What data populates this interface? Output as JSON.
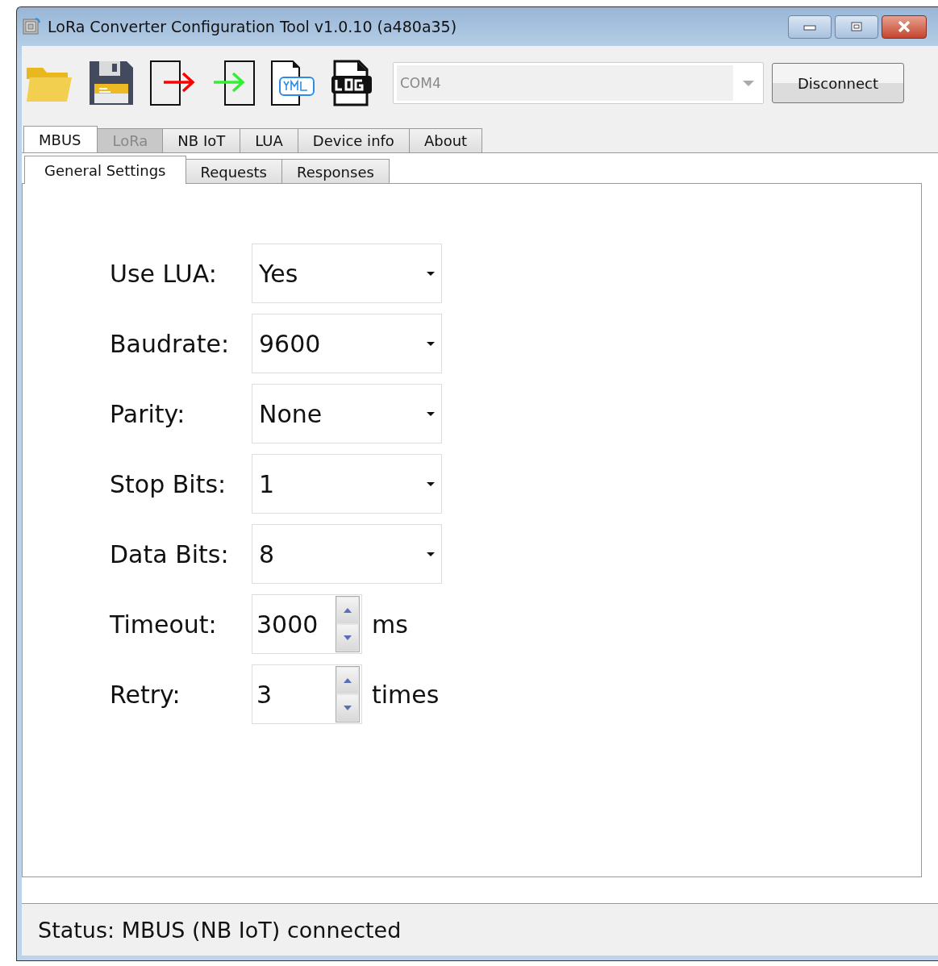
{
  "window": {
    "title": "LoRa Converter Configuration Tool v1.0.10 (a480a35)"
  },
  "toolbar": {
    "port": {
      "value": "COM4",
      "disabled": true
    },
    "disconnect_button": "Disconnect"
  },
  "tabs": [
    {
      "label": "MBUS",
      "selected": true,
      "disabled": false
    },
    {
      "label": "LoRa",
      "selected": false,
      "disabled": true
    },
    {
      "label": "NB IoT",
      "selected": false,
      "disabled": false
    },
    {
      "label": "LUA",
      "selected": false,
      "disabled": false
    },
    {
      "label": "Device info",
      "selected": false,
      "disabled": false
    },
    {
      "label": "About",
      "selected": false,
      "disabled": false
    }
  ],
  "subtabs": [
    {
      "label": "General Settings",
      "selected": true
    },
    {
      "label": "Requests",
      "selected": false
    },
    {
      "label": "Responses",
      "selected": false
    }
  ],
  "settings": [
    {
      "kind": "select",
      "label": "Use LUA:",
      "value": "Yes"
    },
    {
      "kind": "select",
      "label": "Baudrate:",
      "value": "9600"
    },
    {
      "kind": "select",
      "label": "Parity:",
      "value": "None"
    },
    {
      "kind": "select",
      "label": "Stop Bits:",
      "value": "1"
    },
    {
      "kind": "select",
      "label": "Data Bits:",
      "value": "8"
    },
    {
      "kind": "spin",
      "label": "Timeout:",
      "value": "3000",
      "unit": "ms"
    },
    {
      "kind": "spin",
      "label": "Retry:",
      "value": "3",
      "unit": "times"
    }
  ],
  "status_bar": "Status: MBUS (NB IoT) connected"
}
